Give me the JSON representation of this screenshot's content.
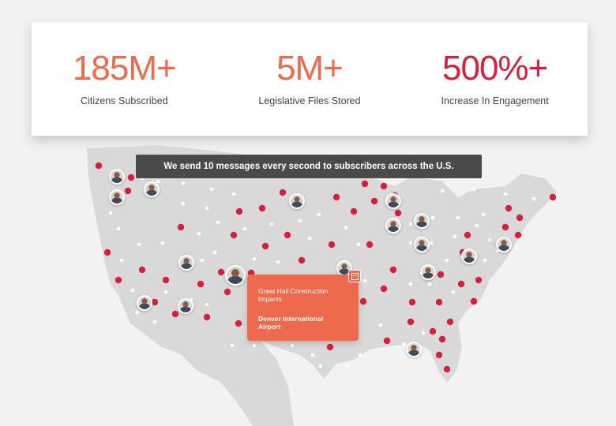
{
  "stats": [
    {
      "value": "185M+",
      "label": "Citizens Subscribed",
      "color": "#ee6a4c"
    },
    {
      "value": "5M+",
      "label": "Legislative Files Stored",
      "color": "#ee6a4c"
    },
    {
      "value": "500%+",
      "label": "Increase In Engagement",
      "color": "#d81e3f"
    }
  ],
  "banner": {
    "text": "We send 10 messages every second to subscribers across the U.S."
  },
  "popup": {
    "subtitle": "Great Hall Construction Impacts",
    "location": "Denver International Airport"
  },
  "icons": [
    "newspaper-icon",
    "avatar"
  ],
  "colors": {
    "accent_orange": "#ee6a4c",
    "accent_red": "#d81e3f",
    "map_fill": "#d9d9d9",
    "banner_bg": "#4a4a4a"
  }
}
